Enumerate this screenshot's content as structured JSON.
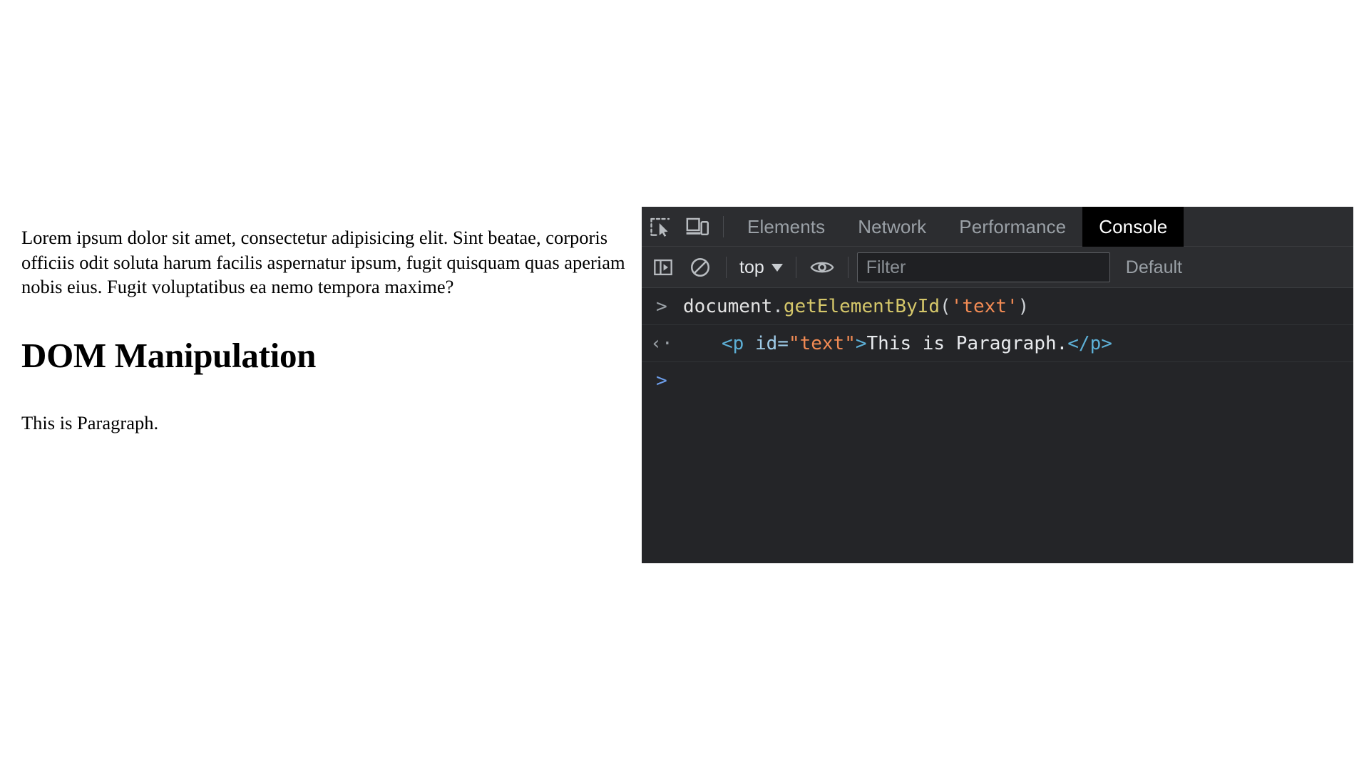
{
  "page": {
    "lorem_paragraph": "Lorem ipsum dolor sit amet, consectetur adipisicing elit. Sint beatae, corporis officiis odit soluta harum facilis aspernatur ipsum, fugit quisquam quas aperiam nobis eius. Fugit voluptatibus ea nemo tempora maxime?",
    "heading": "DOM Manipulation",
    "paragraph": "This is Paragraph."
  },
  "devtools": {
    "tabbar": {
      "inspect_icon": "inspect-element-icon",
      "device_icon": "device-toolbar-icon",
      "tabs": [
        {
          "label": "Elements",
          "active": false
        },
        {
          "label": "Network",
          "active": false
        },
        {
          "label": "Performance",
          "active": false
        },
        {
          "label": "Console",
          "active": true
        }
      ]
    },
    "toolbar": {
      "sidebar_icon": "console-sidebar-icon",
      "clear_icon": "clear-console-icon",
      "context": "top",
      "context_caret": "chevron-down-icon",
      "eye_icon": "live-expression-eye-icon",
      "filter_placeholder": "Filter",
      "levels_label": "Default"
    },
    "console": {
      "rows": [
        {
          "type": "input",
          "gutter": ">",
          "tokens": [
            {
              "text": "document",
              "cls": "tok-plain"
            },
            {
              "text": ".",
              "cls": "tok-punc"
            },
            {
              "text": "getElementById",
              "cls": "tok-prop"
            },
            {
              "text": "(",
              "cls": "tok-punc"
            },
            {
              "text": "'text'",
              "cls": "tok-string"
            },
            {
              "text": ")",
              "cls": "tok-punc"
            }
          ]
        },
        {
          "type": "output",
          "gutter": "‹·",
          "tokens": [
            {
              "text": "<p",
              "cls": "tok-tag"
            },
            {
              "text": " id=",
              "cls": "tok-attr"
            },
            {
              "text": "\"text\"",
              "cls": "tok-attrval"
            },
            {
              "text": ">",
              "cls": "tok-tag"
            },
            {
              "text": "This is Paragraph.",
              "cls": "tok-text"
            },
            {
              "text": "</p>",
              "cls": "tok-tag"
            }
          ]
        },
        {
          "type": "prompt",
          "gutter": ">",
          "tokens": []
        }
      ]
    }
  },
  "colors": {
    "panel_bg": "#242528",
    "toolbar_bg": "#2c2d30",
    "active_tab_bg": "#000000",
    "accent_blue": "#6d9eeb",
    "string_orange": "#f28b54",
    "property_yellow": "#d5c76a",
    "tag_blue": "#5db0d7"
  }
}
